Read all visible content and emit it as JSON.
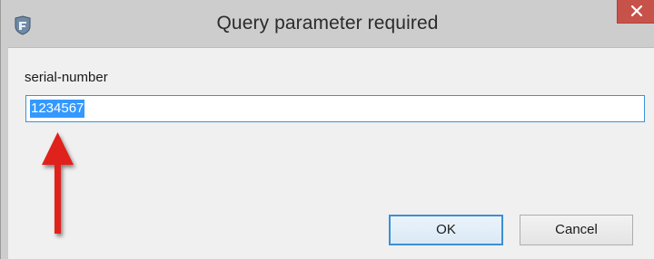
{
  "window": {
    "title": "Query parameter required",
    "app_icon": "app-icon",
    "close_icon": "close-icon"
  },
  "form": {
    "label": "serial-number",
    "value": "1234567"
  },
  "buttons": {
    "ok_label": "OK",
    "cancel_label": "Cancel"
  },
  "annotation": {
    "arrow_icon": "red-arrow-up-icon",
    "arrow_color": "#e0201c"
  },
  "colors": {
    "close_button": "#c7524a",
    "selection": "#3399ff",
    "focus_border": "#3c8fd4"
  }
}
